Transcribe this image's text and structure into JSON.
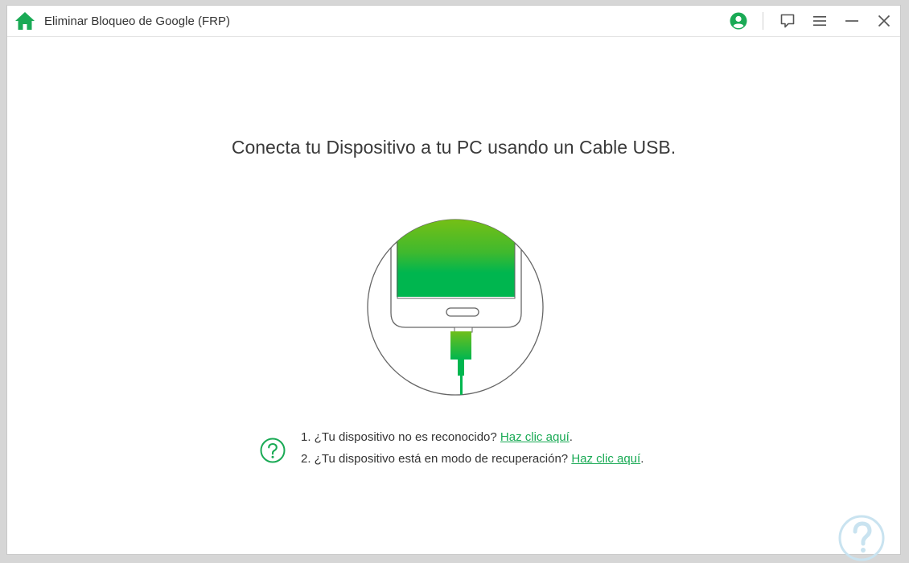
{
  "app": {
    "title": "Eliminar Bloqueo de Google (FRP)"
  },
  "colors": {
    "brand_green": "#1aaa55",
    "screen_gradient_top": "#7ac013",
    "screen_gradient_bottom": "#00b64f"
  },
  "titlebar": {
    "home_icon": "home-icon",
    "account_icon": "user-circle-icon",
    "feedback_icon": "chat-bubble-icon",
    "menu_icon": "hamburger-menu-icon",
    "minimize_icon": "minimize-icon",
    "close_icon": "close-icon"
  },
  "main": {
    "heading": "Conecta tu Dispositivo a tu PC usando un Cable USB.",
    "illustration_icon": "phone-usb-cable-icon",
    "help_icon": "question-circle-icon",
    "tips": [
      {
        "text": "1. ¿Tu dispositivo no es reconocido? ",
        "link": "Haz clic aquí",
        "suffix": "."
      },
      {
        "text": "2. ¿Tu dispositivo está en modo de recuperación? ",
        "link": "Haz clic aquí",
        "suffix": "."
      }
    ]
  }
}
